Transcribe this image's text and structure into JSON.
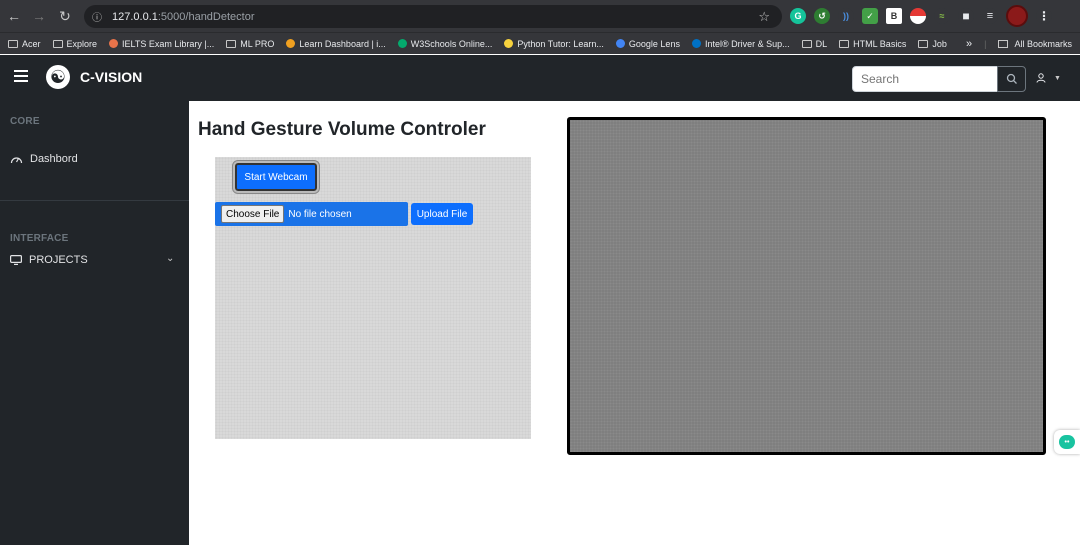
{
  "browser": {
    "url_host": "127.0.0.1",
    "url_path": ":5000/handDetector",
    "bookmarks": [
      {
        "label": "Acer",
        "color": "#c8c8c8"
      },
      {
        "label": "Explore",
        "color": "#c8c8c8"
      },
      {
        "label": "IELTS Exam Library |...",
        "color": "#e8734a"
      },
      {
        "label": "ML PRO",
        "color": "#c8c8c8"
      },
      {
        "label": "Learn Dashboard | i...",
        "color": "#f0a020"
      },
      {
        "label": "W3Schools Online...",
        "color": "#04aa6d"
      },
      {
        "label": "Python Tutor: Learn...",
        "color": "#f7d23e"
      },
      {
        "label": "Google Lens",
        "color": "#4285f4"
      },
      {
        "label": "Intel® Driver & Sup...",
        "color": "#0071c5"
      },
      {
        "label": "DL",
        "color": "#c8c8c8"
      },
      {
        "label": "HTML Basics",
        "color": "#c8c8c8"
      },
      {
        "label": "Job",
        "color": "#c8c8c8"
      }
    ],
    "all_bookmarks": "All Bookmarks"
  },
  "navbar": {
    "brand": "C-VISION",
    "search_placeholder": "Search"
  },
  "sidebar": {
    "core_heading": "CORE",
    "dashboard_label": "Dashbord",
    "interface_heading": "INTERFACE",
    "projects_label": "PROJECTS"
  },
  "main": {
    "title": "Hand Gesture Volume Controler",
    "start_webcam_label": "Start Webcam",
    "choose_file_label": "Choose File",
    "no_file_label": "No file chosen",
    "upload_label": "Upload File"
  },
  "colors": {
    "primary": "#0d6efd",
    "navbar_bg": "#212529",
    "video_bg": "#7f7f7f"
  }
}
